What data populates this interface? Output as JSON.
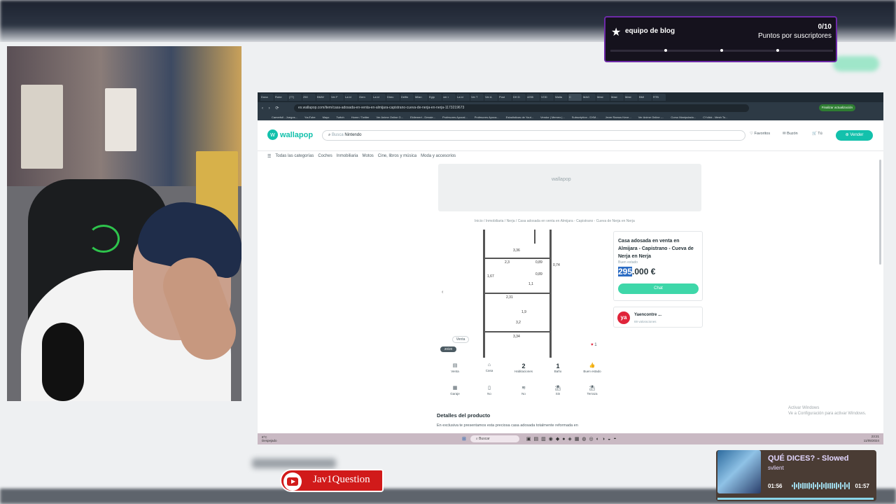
{
  "notification": {
    "title": "equipo de blog",
    "count": "0/10",
    "label": "Puntos por suscriptores",
    "progress": 0
  },
  "browser": {
    "tabs": [
      "Dona",
      "Rube",
      "(77)",
      "250",
      "BMW",
      "Ver F",
      "La id",
      "Gem",
      "La id",
      "Direc",
      "Delfin",
      "Milan",
      "Egip",
      "ver r",
      "La id",
      "Ver T",
      "Ver A",
      "Post",
      "DH D",
      "4255",
      "VOD",
      "Walla",
      "C",
      "MAG",
      "Mest",
      "Mast",
      "Mest",
      "BMI",
      "RTB"
    ],
    "url": "es.wallapop.com/item/casa-adosada-en-venta-en-almijara-capistrano-cueva-de-nerja-en-nerja-1173219673",
    "update_label": "Finalizar actualización",
    "bookmarks": [
      "Camerfull - Juegos...",
      "YouTube",
      "Mayo",
      "Twitch",
      "Home / Twitter",
      "Ver Anime Online G...",
      "Eldlemert - Dessie...",
      "Profesores Apocal...",
      "Profesores Apoca...",
      "Estadísticas de Yout...",
      "Vendor | Memeo |...",
      "Subscription - DXM...",
      "Jever Ramos Keve...",
      "Ver Anime Online -...",
      "Curso Manipulado...",
      "CYclick - Mesh To..."
    ]
  },
  "wallapop": {
    "logo": "wallapop",
    "search_placeholder": "Busca",
    "search_value": "Nintendo",
    "favorites": "Favoritos",
    "messages": "Buzón",
    "you": "Tú",
    "sell": "Vender",
    "categories": [
      "Todas las categorías",
      "Coches",
      "Inmobiliaria",
      "Motos",
      "Cine, libros y música",
      "Moda y accesorios"
    ],
    "ad_logo": "wallapop",
    "breadcrumb": "Inicio / Inmobiliaria / Nerja / Casa adosada en venta en Almijara - Capistrano - Cueva de Nerja en Nerja",
    "gallery_chip": "Venta",
    "gallery_counter": "20/20",
    "likes": "1",
    "floorplan_labels": [
      "3,36",
      "2,3",
      "0,89",
      "0,89",
      "0,74",
      "1,67",
      "2,31",
      "3,2",
      "3,34",
      "1,1",
      "1,9"
    ],
    "features": [
      {
        "icon": "sale-icon",
        "label": "Venta",
        "num": ""
      },
      {
        "icon": "house-icon",
        "label": "Casa",
        "num": ""
      },
      {
        "icon": "",
        "label": "Habitaciones",
        "num": "2"
      },
      {
        "icon": "",
        "label": "Baño",
        "num": "1"
      },
      {
        "icon": "thumb-icon",
        "label": "Buen estado",
        "num": ""
      },
      {
        "icon": "garage-icon",
        "label": "Garaje",
        "num": ""
      },
      {
        "icon": "lift-icon",
        "label": "No",
        "num": ""
      },
      {
        "icon": "pool-icon",
        "label": "No",
        "num": ""
      },
      {
        "icon": "terrace-icon",
        "label": "Sin",
        "num": ""
      },
      {
        "icon": "terrace2-icon",
        "label": "Terraza",
        "num": ""
      }
    ],
    "details_title": "Detalles del producto",
    "details_text": "En exclusiva te presentamos esta preciosa casa adosada totalmente reformada en",
    "card": {
      "title": "Casa adosada en venta en Almijara - Capistrano - Cueva de Nerja en Nerja",
      "condition": "Buen estado",
      "price_highlight": "295",
      "price_rest": ".000 €",
      "chat": "Chat"
    },
    "seller": {
      "avatar": "ya",
      "name": "Yaencontre ...",
      "sub": "69 valoraciones"
    },
    "activate_line1": "Activar Windows",
    "activate_line2": "Ve a Configuración para activar Windows."
  },
  "taskbar": {
    "weather": "8°C",
    "weather_sub": "Despejado",
    "search": "Buscar",
    "clock_time": "23:21",
    "clock_date": "11/05/2024"
  },
  "channel": {
    "name": "Jav1Question"
  },
  "music": {
    "title": "QUÉ DICES? - Slowed",
    "artist": "svlient",
    "elapsed": "01:56",
    "total": "01:57",
    "progress": 0.99
  }
}
